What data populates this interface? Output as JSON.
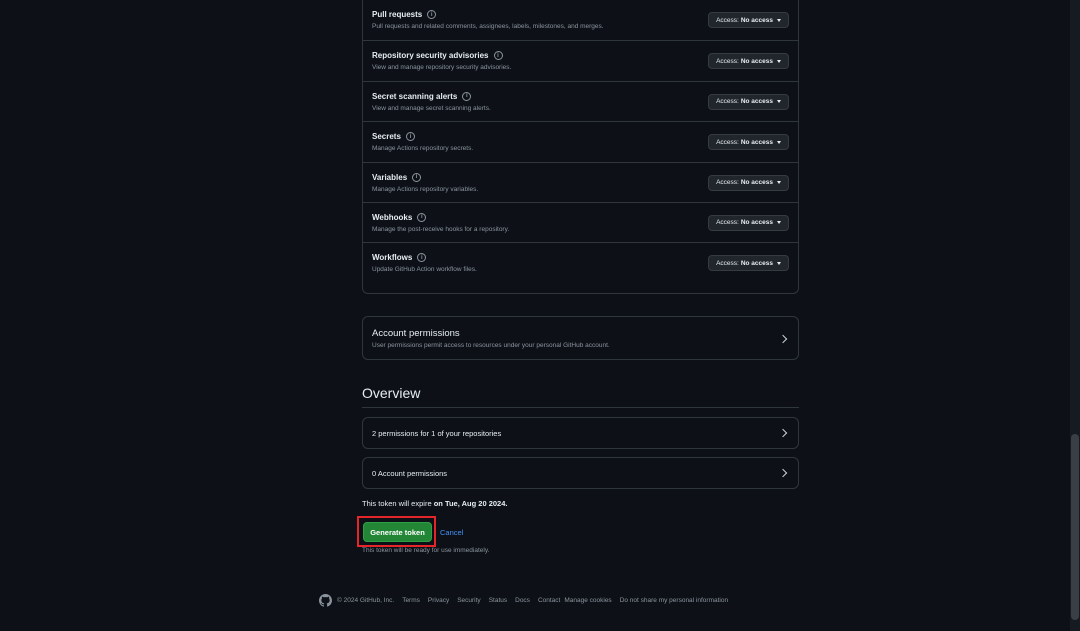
{
  "permissions": [
    {
      "title": "Pull requests",
      "desc": "Pull requests and related comments, assignees, labels, milestones, and merges.",
      "access_prefix": "Access:",
      "access_value": "No access"
    },
    {
      "title": "Repository security advisories",
      "desc": "View and manage repository security advisories.",
      "access_prefix": "Access:",
      "access_value": "No access"
    },
    {
      "title": "Secret scanning alerts",
      "desc": "View and manage secret scanning alerts.",
      "access_prefix": "Access:",
      "access_value": "No access"
    },
    {
      "title": "Secrets",
      "desc": "Manage Actions repository secrets.",
      "access_prefix": "Access:",
      "access_value": "No access"
    },
    {
      "title": "Variables",
      "desc": "Manage Actions repository variables.",
      "access_prefix": "Access:",
      "access_value": "No access"
    },
    {
      "title": "Webhooks",
      "desc": "Manage the post-receive hooks for a repository.",
      "access_prefix": "Access:",
      "access_value": "No access"
    },
    {
      "title": "Workflows",
      "desc": "Update GitHub Action workflow files.",
      "access_prefix": "Access:",
      "access_value": "No access"
    }
  ],
  "account_permissions": {
    "title": "Account permissions",
    "desc": "User permissions permit access to resources under your personal GitHub account."
  },
  "overview": {
    "heading": "Overview",
    "repo_summary": "2 permissions for 1 of your repositories",
    "account_summary": "0 Account permissions"
  },
  "expiry": {
    "prefix": "This token will expire",
    "date": "on Tue, Aug 20 2024."
  },
  "actions": {
    "generate_label": "Generate token",
    "cancel_label": "Cancel",
    "ready_note": "This token will be ready for use immediately."
  },
  "footer": {
    "copyright": "© 2024 GitHub, Inc.",
    "links": [
      "Terms",
      "Privacy",
      "Security",
      "Status",
      "Docs",
      "Contact",
      "Manage cookies",
      "Do not share my personal information"
    ]
  },
  "colors": {
    "background": "#0d1117",
    "border": "#30363d",
    "primary_button": "#238636",
    "link": "#4493f8",
    "highlight": "#e5252a"
  },
  "icons": [
    "info-icon",
    "caret-down-icon",
    "chevron-right-icon",
    "github-logo-icon"
  ]
}
